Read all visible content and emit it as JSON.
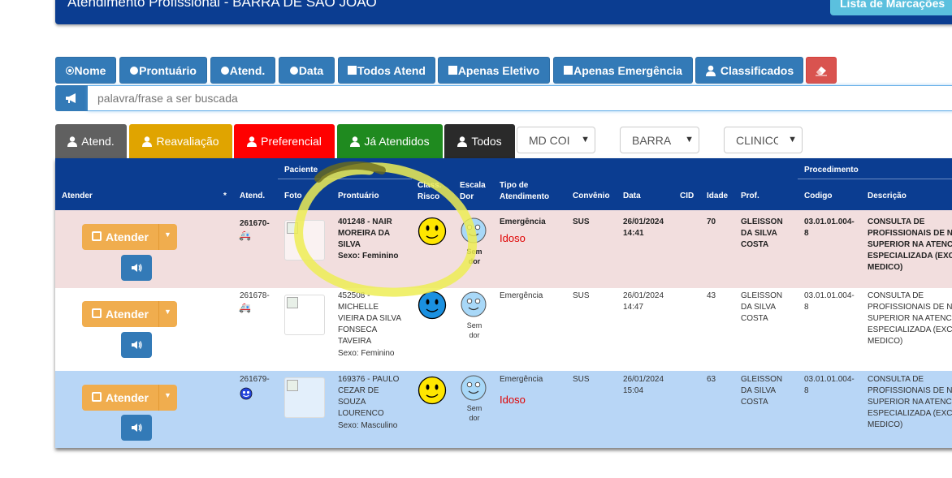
{
  "header": {
    "title": "Atendimento Profissional - BARRA DE SÃO JOÃO",
    "lista_button": "Lista de Marcações"
  },
  "filters": {
    "nome": "Nome",
    "prontuario": "Prontuário",
    "atend": "Atend.",
    "data": "Data",
    "todos_atend": "Todos Atend",
    "apenas_eletivo": "Apenas Eletivo",
    "apenas_emergencia": "Apenas Emergência",
    "classificados": "Classificados"
  },
  "search": {
    "placeholder": "palavra/frase a ser buscada"
  },
  "tabs": {
    "atend": "Atend.",
    "reavaliacao": "Reavaliação",
    "preferencial": "Preferencial",
    "ja_atendidos": "Já Atendidos",
    "todos": "Todos"
  },
  "selects": {
    "medico": "MD COI",
    "unidade": "BARRA",
    "setor": "CLINICO"
  },
  "colors": {
    "header_blue": "#0b3d91",
    "btn_blue": "#337ab7",
    "warning": "#f0ad4e",
    "danger": "#d9534f",
    "row_emergency": "#f2dede",
    "row_highlight": "#b8d6f6",
    "annotation": "#f2f26a"
  },
  "table": {
    "headers": {
      "atender": "Atender",
      "star": "*",
      "atend": "Atend.",
      "paciente": "Paciente",
      "foto": "Foto",
      "prontuario": "Prontuário",
      "class_risco": "Class.\nRisco",
      "escala_dor": "Escala\nDor",
      "tipo_atendimento": "Tipo de\nAtendimento",
      "convenio": "Convênio",
      "data": "Data",
      "cid": "CID",
      "idade": "Idade",
      "prof": "Prof.",
      "procedimento": "Procedimento",
      "codigo": "Codigo",
      "descricao": "Descrição"
    },
    "atender_label": "Atender",
    "sem_dor": "Sem\ndor",
    "rows": [
      {
        "atend": "261670-",
        "transport_icon": "ambulance-icon",
        "prontuario": "401248 - NAIR\nMOREIRA DA\nSILVA",
        "sexo": "Sexo: Feminino",
        "risco": "yellow",
        "tipo": "Emergência",
        "flag": "Idoso",
        "convenio": "SUS",
        "data": "26/01/2024\n14:41",
        "idade": "70",
        "prof": "GLEISSON\nDA SILVA\nCOSTA",
        "codigo": "03.01.01.004-\n8",
        "descricao": "CONSULTA DE\nPROFISSIONAIS DE N\nSUPERIOR NA ATENC\nESPECIALIZADA (EXC\nMEDICO)"
      },
      {
        "atend": "261678-",
        "transport_icon": "ambulance-icon",
        "prontuario": "452508 -\nMICHELLE\nVIEIRA DA SILVA\nFONSECA\nTAVEIRA",
        "sexo": "Sexo: Feminino",
        "risco": "blue",
        "tipo": "Emergência",
        "flag": "",
        "convenio": "SUS",
        "data": "26/01/2024\n14:47",
        "idade": "43",
        "prof": "GLEISSON\nDA SILVA\nCOSTA",
        "codigo": "03.01.01.004-\n8",
        "descricao": "CONSULTA DE\nPROFISSIONAIS DE N\nSUPERIOR NA ATENC\nESPECIALIZADA (EXC\nMEDICO)"
      },
      {
        "atend": "261679-",
        "transport_icon": "face-icon",
        "prontuario": "169376 - PAULO\nCEZAR DE\nSOUZA\nLOURENCO",
        "sexo": "Sexo: Masculino",
        "risco": "yellow",
        "tipo": "Emergência",
        "flag": "Idoso",
        "convenio": "SUS",
        "data": "26/01/2024\n15:04",
        "idade": "63",
        "prof": "GLEISSON\nDA SILVA\nCOSTA",
        "codigo": "03.01.01.004-\n8",
        "descricao": "CONSULTA DE\nPROFISSIONAIS DE N\nSUPERIOR NA ATENC\nESPECIALIZADA (EXC\nMEDICO)"
      }
    ]
  }
}
